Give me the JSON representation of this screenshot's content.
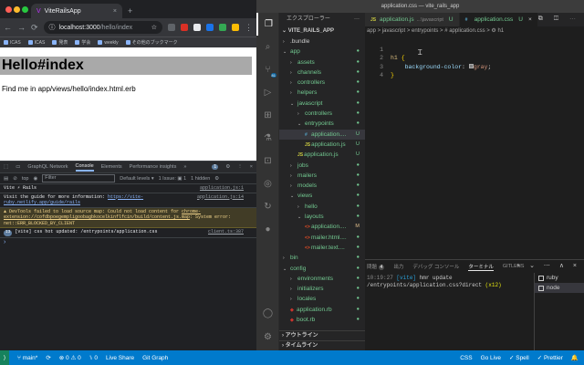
{
  "browser": {
    "tab_title": "ViteRailsApp",
    "tab_close": "×",
    "new_tab": "+",
    "url_host": "localhost:3000",
    "url_path": "/hello/index",
    "bookmarks": [
      "ICAS",
      "ICAS",
      "発表",
      "学会",
      "weekly",
      "その他のブックマーク"
    ],
    "page": {
      "heading": "Hello#index",
      "text": "Find me in app/views/hello/index.html.erb"
    },
    "devtools": {
      "tabs": [
        "GraphQL Network",
        "Console",
        "Elements",
        "Performance insights"
      ],
      "active_tab": "Console",
      "issues_label": "1",
      "context": "top",
      "filter_placeholder": "Filter",
      "levels": "Default levels ▾",
      "issues": "1 Issue: ▣ 1",
      "hidden": "1 hidden",
      "logs": [
        {
          "text": "Vite ⚡ Rails",
          "src": "application.js:1"
        },
        {
          "text": "Visit the guide for more information: ",
          "link": "https://vite-ruby.netlify.app/guide/rails",
          "src": "application.js:14"
        },
        {
          "text": "▲ DevTools failed to load source map: Could not load content for ",
          "link": "chrome-extension://cofdbpoegempligoobagbkocelkinflfcin/build/content.js.map",
          "tail": ": System error: net::ERR_BLOCKED_BY_CLIENT",
          "src": ""
        },
        {
          "badge": "13",
          "text": "[vite] css hot updated: /entrypoints/application.css",
          "src": "client.ts:387"
        }
      ],
      "prompt": "›"
    }
  },
  "vscode": {
    "title": "application.css — vite_rails_app",
    "explorer_title": "エクスプローラー",
    "explorer_dots": "···",
    "root": "VITE_RAILS_APP",
    "tree": [
      {
        "label": ".bundle",
        "depth": 1,
        "chev": "›",
        "plain": true,
        "mark": ""
      },
      {
        "label": "app",
        "depth": 1,
        "chev": "⌄",
        "mark": "●"
      },
      {
        "label": "assets",
        "depth": 2,
        "chev": "›",
        "mark": "●"
      },
      {
        "label": "channels",
        "depth": 2,
        "chev": "›",
        "mark": "●"
      },
      {
        "label": "controllers",
        "depth": 2,
        "chev": "›",
        "mark": "●"
      },
      {
        "label": "helpers",
        "depth": 2,
        "chev": "›",
        "mark": "●"
      },
      {
        "label": "javascript",
        "depth": 2,
        "chev": "⌄",
        "mark": "●"
      },
      {
        "label": "controllers",
        "depth": 3,
        "chev": "›",
        "mark": "●"
      },
      {
        "label": "entrypoints",
        "depth": 3,
        "chev": "⌄",
        "mark": "●"
      },
      {
        "label": "application....",
        "depth": 4,
        "icon": "#",
        "icolor": "#519aba",
        "mark": "U",
        "selected": true
      },
      {
        "label": "application.js",
        "depth": 4,
        "icon": "JS",
        "icolor": "#cbcb41",
        "mark": "U"
      },
      {
        "label": "application.js",
        "depth": 3,
        "icon": "JS",
        "icolor": "#cbcb41",
        "mark": "U"
      },
      {
        "label": "jobs",
        "depth": 2,
        "chev": "›",
        "mark": "●"
      },
      {
        "label": "mailers",
        "depth": 2,
        "chev": "›",
        "mark": "●"
      },
      {
        "label": "models",
        "depth": 2,
        "chev": "›",
        "mark": "●"
      },
      {
        "label": "views",
        "depth": 2,
        "chev": "⌄",
        "mark": "●"
      },
      {
        "label": "hello",
        "depth": 3,
        "chev": "›",
        "mark": "●"
      },
      {
        "label": "layouts",
        "depth": 3,
        "chev": "⌄",
        "mark": "●"
      },
      {
        "label": "application....",
        "depth": 4,
        "icon": "<>",
        "icolor": "#e44d26",
        "mark": "M"
      },
      {
        "label": "mailer.html....",
        "depth": 4,
        "icon": "<>",
        "icolor": "#e44d26",
        "mark": "●"
      },
      {
        "label": "mailer.text....",
        "depth": 4,
        "icon": "<>",
        "icolor": "#e44d26",
        "mark": "●"
      },
      {
        "label": "bin",
        "depth": 1,
        "chev": "›",
        "mark": "●"
      },
      {
        "label": "config",
        "depth": 1,
        "chev": "⌄",
        "mark": "●"
      },
      {
        "label": "environments",
        "depth": 2,
        "chev": "›",
        "mark": "●"
      },
      {
        "label": "initializers",
        "depth": 2,
        "chev": "›",
        "mark": "●"
      },
      {
        "label": "locales",
        "depth": 2,
        "chev": "›",
        "mark": "●"
      },
      {
        "label": "application.rb",
        "depth": 2,
        "icon": "◆",
        "icolor": "#cc342d",
        "mark": "●"
      },
      {
        "label": "boot.rb",
        "depth": 2,
        "icon": "◆",
        "icolor": "#cc342d",
        "mark": "●"
      }
    ],
    "outline_label": "アウトライン",
    "timeline_label": "タイムライン",
    "editor_tabs": [
      {
        "icon": "JS",
        "name": "application.js",
        "sub": "...\\javascript",
        "mark": "U",
        "active": false
      },
      {
        "icon": "#",
        "name": "application.css",
        "sub": "",
        "mark": "U",
        "active": true
      }
    ],
    "tab_close": "×",
    "editor_actions": "⧉ ◫ ⋯",
    "breadcrumb": "app > javascript > entrypoints > # application.css > ⚙ h1",
    "code": [
      {
        "n": "1",
        "sel": "h1",
        "open": " {"
      },
      {
        "n": "2",
        "prop": "background-color",
        "value": "gray"
      },
      {
        "n": "3",
        "close": "}"
      },
      {
        "n": "4"
      }
    ],
    "panel_tabs": [
      "問題",
      "出力",
      "デバッグ コンソール",
      "ターミナル",
      "GITLENS"
    ],
    "problems_count": "4",
    "active_panel": "ターミナル",
    "panel_actions": "+ ⌄ ⋯ ∧ ×",
    "terminal": {
      "time": "10:19:27",
      "tag": "[vite]",
      "msg": "hmr update /entrypoints/application.css?direct",
      "count": "(x12)"
    },
    "terminal_list": [
      {
        "name": "ruby",
        "active": false
      },
      {
        "name": "node",
        "active": true
      }
    ],
    "status": {
      "branch": "⑂ main*",
      "sync": "⟳",
      "errors": "⊗ 0 ⚠ 0",
      "port": "⑊ 0",
      "live_share": "Live Share",
      "git_graph": "Git Graph",
      "css": "CSS",
      "golive": "Go Live",
      "spell": "✓ Spell",
      "prettier": "✓ Prettier",
      "bell": "🔔"
    }
  }
}
